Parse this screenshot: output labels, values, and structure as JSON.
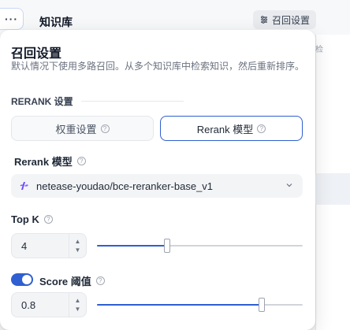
{
  "header": {
    "more_label": "···",
    "title": "知识库",
    "recall_button_label": "召回设置",
    "right_panel_text": "检"
  },
  "popover": {
    "title": "召回设置",
    "description": "默认情况下使用多路召回。从多个知识库中检索知识，然后重新排序。",
    "section_rerank": "RERANK 设置",
    "modes": {
      "weight_label": "权重设置",
      "rerank_label": "Rerank 模型",
      "selected": "rerank"
    },
    "model": {
      "label": "Rerank 模型",
      "value": "netease-youdao/bce-reranker-base_v1"
    },
    "top_k": {
      "label": "Top K",
      "value": "4",
      "slider_fraction": 0.34
    },
    "score": {
      "label": "Score 阈值",
      "enabled": true,
      "value": "0.8",
      "slider_fraction": 0.8
    }
  },
  "colors": {
    "accent": "#2f5fd0",
    "page_bg": "#f3f4f6"
  }
}
